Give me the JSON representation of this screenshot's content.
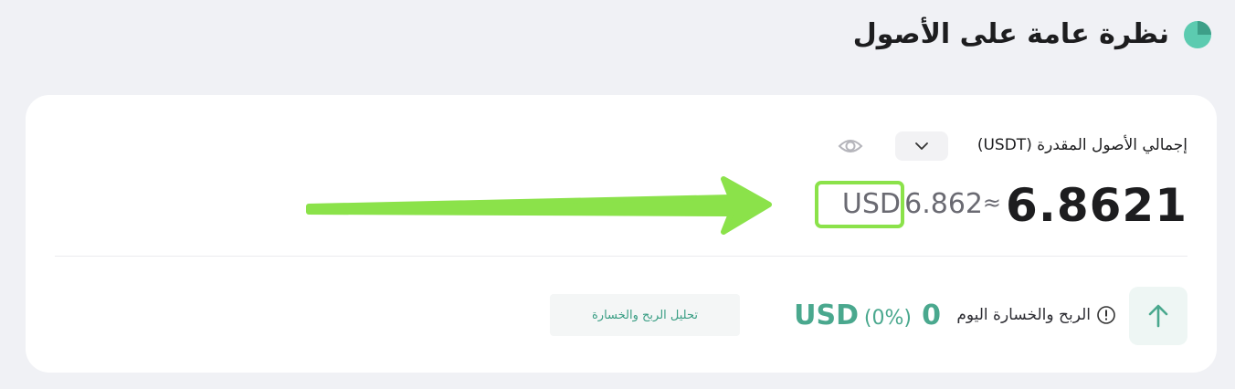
{
  "header": {
    "title": "نظرة عامة على الأصول",
    "icon": "pie-chart-icon",
    "accent": "#5ccbb0"
  },
  "card": {
    "estimated_label": "إجمالي الأصول المقدرة (USDT)",
    "dropdown_icon": "chevron-down-icon",
    "visibility_icon": "eye-icon",
    "total_value": "6.8621",
    "approx_sign": "≈",
    "approx_value": "6.862",
    "approx_currency": "USD",
    "pnl": {
      "icon": "arrow-up-icon",
      "info_icon": "info-icon",
      "label": "الربح والخسارة اليوم",
      "value": "0",
      "percent": "(0%)",
      "currency": "USD",
      "color": "#4aa88e"
    },
    "analysis_button_label": "تحليل الربح والخسارة"
  },
  "annotation": {
    "color": "#8be24a",
    "shape": "arrow-and-highlight-box"
  }
}
